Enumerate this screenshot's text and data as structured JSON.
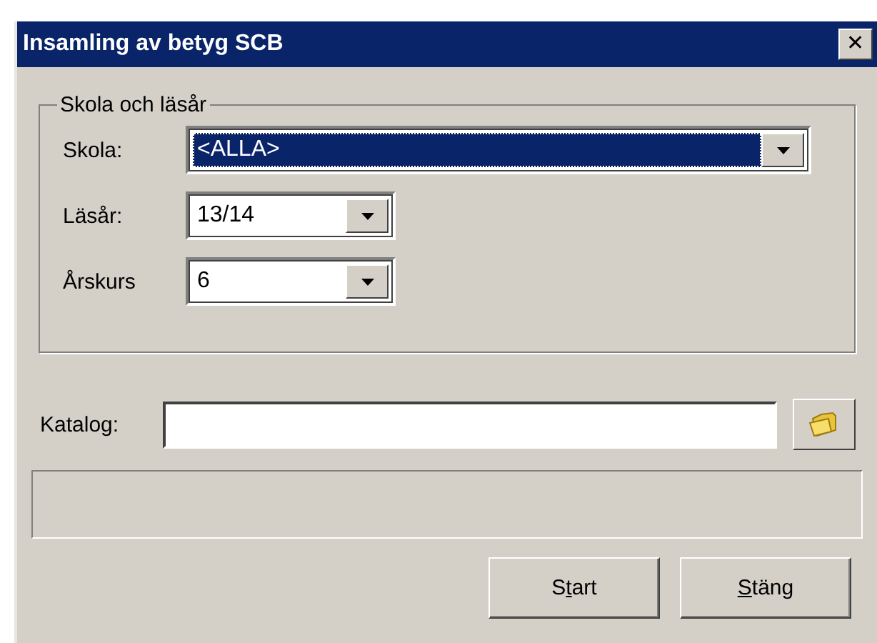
{
  "window": {
    "title": "Insamling av betyg SCB",
    "close_glyph": "✕"
  },
  "group": {
    "title": "Skola och läsår",
    "fields": [
      {
        "label": "Skola:",
        "value": "<ALLA>",
        "highlighted": true,
        "kind": "wide"
      },
      {
        "label": "Läsår:",
        "value": "13/14",
        "highlighted": false,
        "kind": "narrow"
      },
      {
        "label": "Årskurs",
        "value": "6",
        "highlighted": false,
        "kind": "narrow"
      }
    ]
  },
  "catalog": {
    "label": "Katalog:"
  },
  "buttons": [
    {
      "before": "S",
      "mnemonic": "t",
      "after": "art"
    },
    {
      "mnemonic": "S",
      "after": "täng"
    }
  ]
}
